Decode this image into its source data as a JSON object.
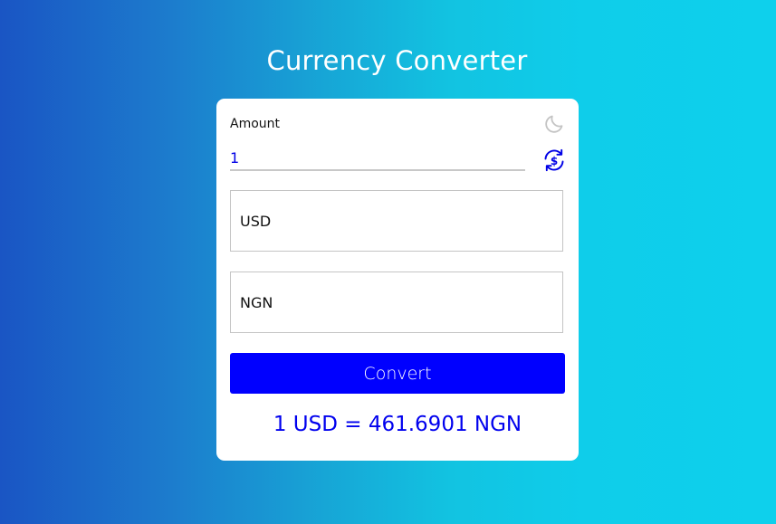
{
  "app": {
    "title": "Currency Converter"
  },
  "form": {
    "amount_label": "Amount",
    "amount_value": "1",
    "from_currency": "USD",
    "to_currency": "NGN",
    "convert_label": "Convert",
    "result": "1 USD = 461.6901 NGN"
  },
  "icons": {
    "theme_toggle": "moon-icon",
    "swap": "currency-swap-icon"
  },
  "colors": {
    "accent": "#0000ff",
    "result_text": "#0000ee",
    "gradient_start": "#1a55c4",
    "gradient_end": "#0ed0ec",
    "moon_icon": "#c4c4c4"
  }
}
